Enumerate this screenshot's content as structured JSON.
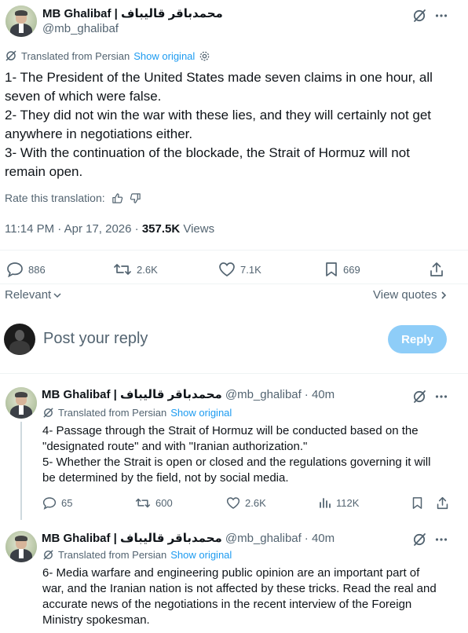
{
  "main_post": {
    "author_name": "محمدباقر قالیباف | MB Ghalibaf",
    "handle": "@mb_ghalibaf",
    "translated_from": "Translated from Persian",
    "show_original": "Show original",
    "lines": [
      "1- The President of the United States made seven claims in one hour, all",
      "seven of which were false.",
      "2- They did not win the war with these lies, and they will certainly not get",
      "anywhere in negotiations either.",
      "3- With the continuation of the blockade, the Strait of Hormuz will not",
      "remain open."
    ],
    "rate_translation": "Rate this translation:",
    "timestamp": "11:14 PM · Apr 17, 2026 · ",
    "views_count": "357.5K",
    "views_label": " Views",
    "replies": "886",
    "reposts": "2.6K",
    "likes": "7.1K",
    "bookmarks": "669"
  },
  "sort": {
    "relevant_label": "Relevant",
    "view_quotes_label": "View quotes"
  },
  "composer": {
    "placeholder": "Post your reply",
    "reply_button": "Reply"
  },
  "replies": [
    {
      "author_name": "محمدباقر قالیباف | MB Ghalibaf",
      "handle": "@mb_ghalibaf",
      "time": "· 40m",
      "translated_from": "Translated from Persian",
      "show_original": "Show original",
      "lines": [
        "4- Passage through the Strait of Hormuz will be conducted based on the",
        "\"designated route\" and with \"Iranian authorization.\"",
        "5- Whether the Strait is open or closed and the regulations governing it will",
        "be determined by the field, not by social media."
      ],
      "replies": "65",
      "reposts": "600",
      "likes": "2.6K",
      "views": "112K"
    },
    {
      "author_name": "محمدباقر قالیباف | MB Ghalibaf",
      "handle": "@mb_ghalibaf",
      "time": "· 40m",
      "translated_from": "Translated from Persian",
      "show_original": "Show original",
      "lines": [
        "6- Media warfare and engineering public opinion are an important part of",
        "war, and the Iranian nation is not affected by these tricks. Read the real and",
        "accurate news of the negotiations in the recent interview of the Foreign",
        "Ministry spokesman."
      ]
    }
  ],
  "colors": {
    "accent": "#1d9bf0",
    "muted": "#536471",
    "reply_button": "#8ecdf8"
  }
}
